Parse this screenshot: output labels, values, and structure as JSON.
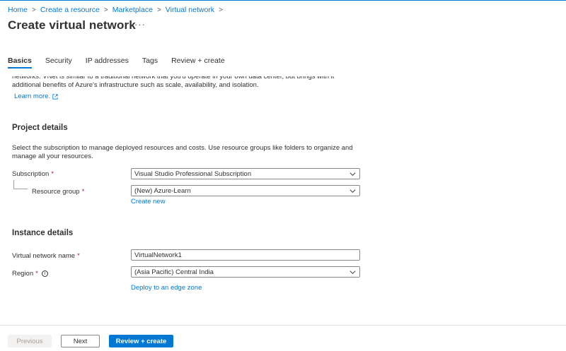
{
  "breadcrumb": {
    "items": [
      "Home",
      "Create a resource",
      "Marketplace",
      "Virtual network"
    ],
    "separator": ">"
  },
  "page": {
    "title": "Create virtual network",
    "more": "···"
  },
  "tabs": [
    "Basics",
    "Security",
    "IP addresses",
    "Tags",
    "Review + create"
  ],
  "intro": {
    "text": "networks. VNet is similar to a traditional network that you'd operate in your own data center, but brings with it additional benefits of Azure's infrastructure such as scale, availability, and isolation.",
    "learn_more": "Learn more."
  },
  "project": {
    "heading": "Project details",
    "description": "Select the subscription to manage deployed resources and costs. Use resource groups like folders to organize and manage all your resources.",
    "subscription_label": "Subscription",
    "subscription_value": "Visual Studio Professional Subscription",
    "resource_group_label": "Resource group",
    "resource_group_value": "(New) Azure-Learn",
    "create_new": "Create new",
    "required_mark": "*"
  },
  "instance": {
    "heading": "Instance details",
    "name_label": "Virtual network name",
    "name_value": "VirtualNetwork1",
    "region_label": "Region",
    "region_value": "(Asia Pacific) Central India",
    "edge_zone": "Deploy to an edge zone",
    "info_glyph": "i",
    "required_mark": "*"
  },
  "footer": {
    "previous": "Previous",
    "next": "Next",
    "review_create": "Review + create"
  },
  "colors": {
    "accent": "#0078d4",
    "required": "#a4262c",
    "text": "#323130",
    "border": "#8a8886"
  },
  "icons": {
    "external_link": "external-link-icon",
    "chevron": "chevron-down-icon",
    "info": "info-icon"
  }
}
